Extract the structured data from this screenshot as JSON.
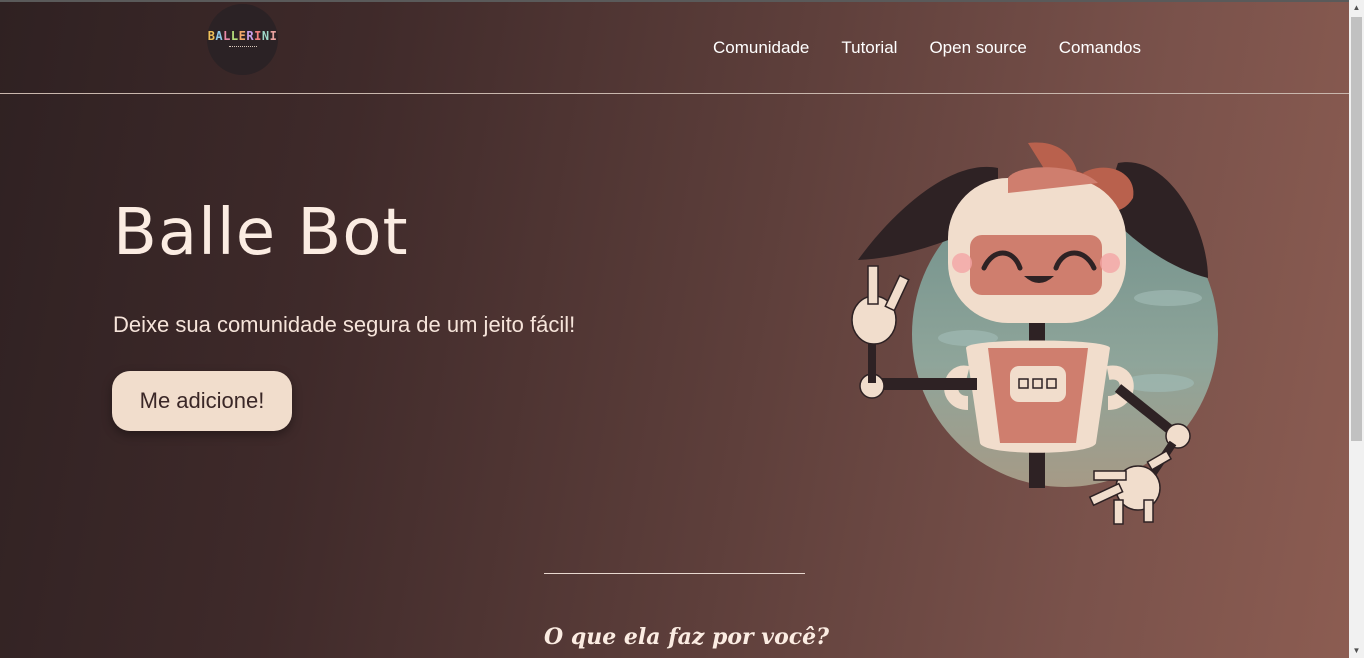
{
  "header": {
    "logo_text": "BALLERINI",
    "nav": [
      {
        "label": "Comunidade"
      },
      {
        "label": "Tutorial"
      },
      {
        "label": "Open source"
      },
      {
        "label": "Comandos"
      }
    ]
  },
  "hero": {
    "title": "Balle Bot",
    "subtitle": "Deixe sua comunidade segura de um jeito fácil!",
    "cta_label": "Me adicione!"
  },
  "section": {
    "title": "O que ela faz por você?"
  },
  "colors": {
    "accent_pink": "#cf7e6e",
    "cream": "#f1ddcc",
    "dark": "#2f2122"
  },
  "icons": {
    "robot": "robot-mascot-illustration"
  }
}
